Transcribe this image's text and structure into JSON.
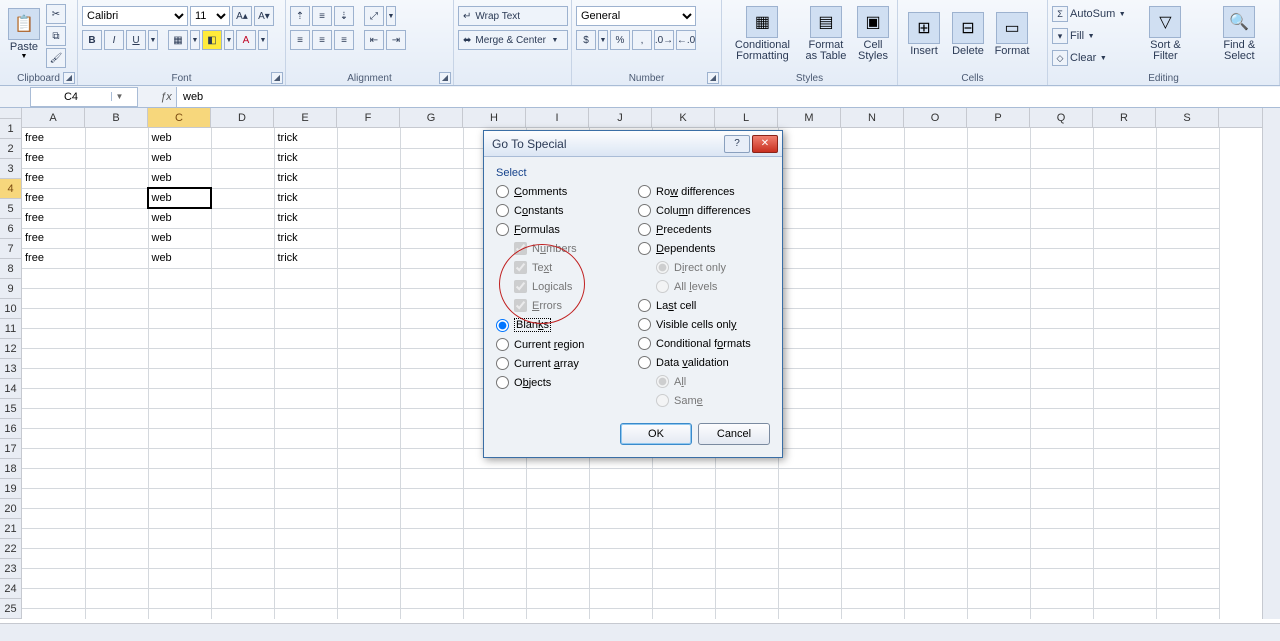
{
  "ribbon": {
    "clipboard": {
      "label": "Clipboard",
      "paste": "Paste"
    },
    "font": {
      "label": "Font",
      "name": "Calibri",
      "size": "11",
      "bold": "B",
      "italic": "I",
      "underline": "U"
    },
    "alignment": {
      "label": "Alignment",
      "wrap": "Wrap Text",
      "merge": "Merge & Center"
    },
    "number": {
      "label": "Number",
      "format": "General"
    },
    "styles": {
      "label": "Styles",
      "cond": "Conditional\nFormatting",
      "table": "Format\nas Table",
      "cell": "Cell\nStyles"
    },
    "cells": {
      "label": "Cells",
      "insert": "Insert",
      "delete": "Delete",
      "format": "Format"
    },
    "editing": {
      "label": "Editing",
      "autosum": "AutoSum",
      "fill": "Fill",
      "clear": "Clear",
      "sort": "Sort &\nFilter",
      "find": "Find &\nSelect"
    }
  },
  "namebox": "C4",
  "formula": "web",
  "columns": [
    "A",
    "B",
    "C",
    "D",
    "E",
    "F",
    "G",
    "H",
    "I",
    "J",
    "K",
    "L",
    "M",
    "N",
    "O",
    "P",
    "Q",
    "R",
    "S"
  ],
  "rows": [
    "1",
    "2",
    "3",
    "4",
    "5",
    "6",
    "7",
    "8",
    "9",
    "10",
    "11",
    "12",
    "13",
    "14",
    "15",
    "16",
    "17",
    "18",
    "19",
    "20",
    "21",
    "22",
    "23",
    "24",
    "25"
  ],
  "cells": {
    "A1": "free",
    "C1": "web",
    "E1": "trick",
    "A2": "free",
    "C2": "web",
    "E2": "trick",
    "A3": "free",
    "C3": "web",
    "E3": "trick",
    "A4": "free",
    "C4": "web",
    "E4": "trick",
    "A5": "free",
    "C5": "web",
    "E5": "trick",
    "A6": "free",
    "C6": "web",
    "E6": "trick",
    "A7": "free",
    "C7": "web",
    "E7": "trick"
  },
  "selected_cell": "C4",
  "dialog": {
    "title": "Go To Special",
    "section": "Select",
    "left": {
      "comments": "Comments",
      "constants": "Constants",
      "formulas": "Formulas",
      "numbers": "Numbers",
      "text": "Text",
      "logicals": "Logicals",
      "errors": "Errors",
      "blanks": "Blanks",
      "current_region": "Current region",
      "current_array": "Current array",
      "objects": "Objects"
    },
    "right": {
      "row_diff": "Row differences",
      "col_diff": "Column differences",
      "precedents": "Precedents",
      "dependents": "Dependents",
      "direct_only": "Direct only",
      "all_levels": "All levels",
      "last_cell": "Last cell",
      "visible": "Visible cells only",
      "cond_formats": "Conditional formats",
      "data_val": "Data validation",
      "all": "All",
      "same": "Same"
    },
    "ok": "OK",
    "cancel": "Cancel"
  }
}
